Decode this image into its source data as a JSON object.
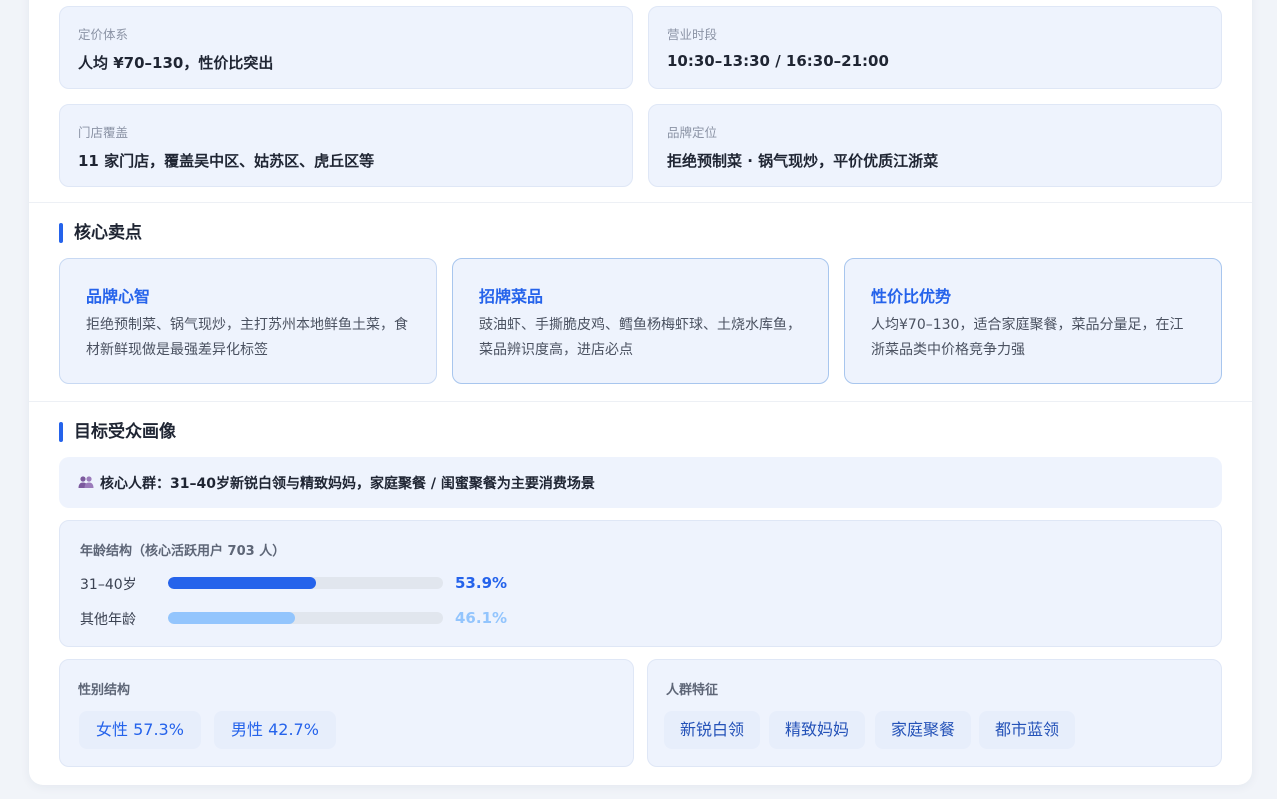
{
  "info": {
    "pricing": {
      "label": "定价体系",
      "value": "人均 ¥70–130，性价比突出"
    },
    "hours": {
      "label": "营业时段",
      "value": "10:30–13:30 / 16:30–21:00"
    },
    "stores": {
      "label": "门店覆盖",
      "value": "11 家门店，覆盖吴中区、姑苏区、虎丘区等"
    },
    "positioning": {
      "label": "品牌定位",
      "value": "拒绝预制菜 · 锅气现炒，平价优质江浙菜"
    }
  },
  "selling_points": {
    "title": "核心卖点",
    "items": [
      {
        "title": "品牌心智",
        "desc": "拒绝预制菜、锅气现炒，主打苏州本地鲜鱼土菜，食材新鲜现做是最强差异化标签"
      },
      {
        "title": "招牌菜品",
        "desc": "豉油虾、手撕脆皮鸡、鳕鱼杨梅虾球、土烧水库鱼，菜品辨识度高，进店必点"
      },
      {
        "title": "性价比优势",
        "desc": "人均¥70–130，适合家庭聚餐，菜品分量足，在江浙菜品类中价格竞争力强"
      }
    ]
  },
  "audience": {
    "title": "目标受众画像",
    "core_icon": "people-icon",
    "core_text": "核心人群：31–40岁新锐白领与精致妈妈，家庭聚餐 / 闺蜜聚餐为主要消费场景",
    "age": {
      "label": "年龄结构（核心活跃用户 703 人）",
      "rows": [
        {
          "label": "31–40岁",
          "value": 53.9,
          "pct": "53.9%",
          "color": "#2563eb"
        },
        {
          "label": "其他年龄",
          "value": 46.1,
          "pct": "46.1%",
          "color": "#93c5fd"
        }
      ]
    },
    "gender": {
      "label": "性别结构",
      "female": "女性 57.3%",
      "male": "男性 42.7%"
    },
    "traits": {
      "label": "人群特征",
      "tags": [
        "新锐白领",
        "精致妈妈",
        "家庭聚餐",
        "都市蓝领"
      ]
    }
  }
}
